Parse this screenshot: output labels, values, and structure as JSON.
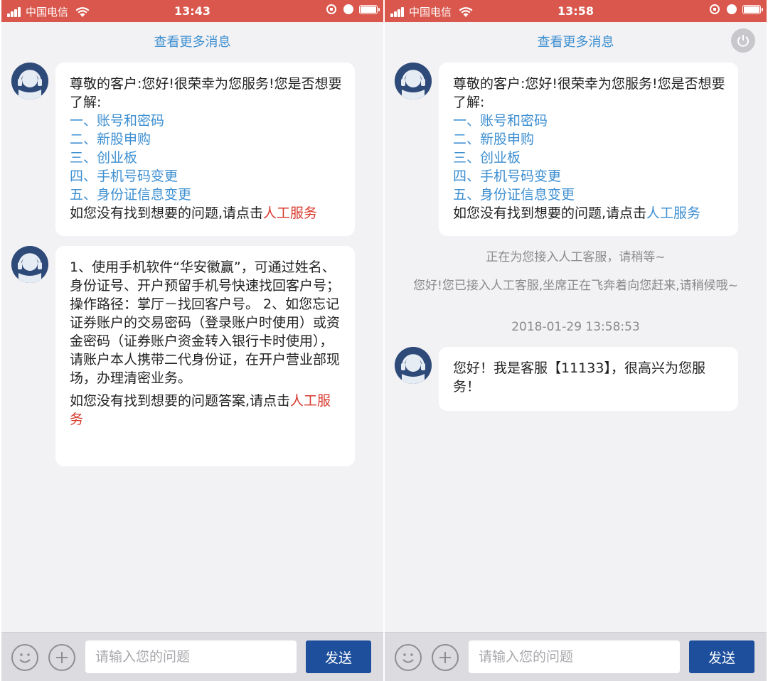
{
  "left": {
    "status": {
      "carrier": "中国电信",
      "time": "13:43"
    },
    "more_messages": "查看更多消息",
    "bubble1": {
      "greeting": "尊敬的客户:您好!很荣幸为您服务!您是否想要了解:",
      "options": [
        "一、账号和密码",
        "二、新股申购",
        "三、创业板",
        "四、手机号码变更",
        "五、身份证信息变更"
      ],
      "footer_prefix": "如您没有找到想要的问题,请点击",
      "footer_link": "人工服务"
    },
    "bubble2": {
      "answer": "1、使用手机软件“华安徽赢”，可通过姓名、身份证号、开户预留手机号快速找回客户号；操作路径：掌厅－找回客户号。 2、如您忘记证券账户的交易密码（登录账户时使用）或资金密码（证券账户资金转入银行卡时使用），请账户本人携带二代身份证，在开户营业部现场，办理清密业务。",
      "footer_prefix": "如您没有找到想要的问题答案,请点击",
      "footer_link": "人工服务"
    },
    "input": {
      "placeholder": "请输入您的问题",
      "send_label": "发送"
    }
  },
  "right": {
    "status": {
      "carrier": "中国电信",
      "time": "13:58"
    },
    "more_messages": "查看更多消息",
    "bubble1": {
      "greeting": "尊敬的客户:您好!很荣幸为您服务!您是否想要了解:",
      "options": [
        "一、账号和密码",
        "二、新股申购",
        "三、创业板",
        "四、手机号码变更",
        "五、身份证信息变更"
      ],
      "footer_prefix": "如您没有找到想要的问题,请点击",
      "footer_link": "人工服务"
    },
    "system_connecting": "正在为您接入人工客服，请稍等~",
    "system_connected": "您好!您已接入人工客服,坐席正在飞奔着向您赶来,请稍候哦~",
    "timestamp": "2018-01-29 13:58:53",
    "bubble2": {
      "text": "您好！我是客服【11133】，很高兴为您服务！"
    },
    "input": {
      "placeholder": "请输入您的问题",
      "send_label": "发送"
    }
  },
  "colors": {
    "status_bar": "#d9574c",
    "link_blue": "#3d8fd1",
    "link_red": "#d8392d",
    "send_button": "#1e4f9c"
  }
}
